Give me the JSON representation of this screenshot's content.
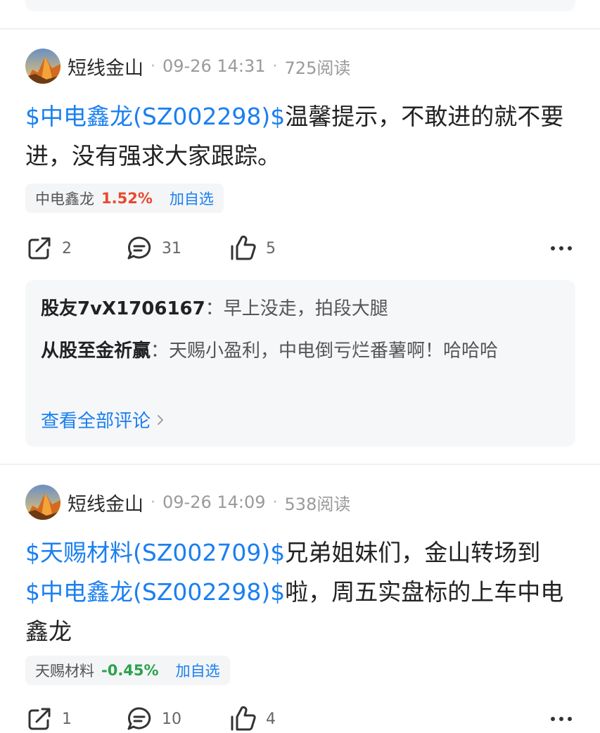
{
  "posts": [
    {
      "author": "短线金山",
      "dot": "·",
      "time": "09-26 14:31",
      "reads": "725阅读",
      "content_parts": [
        {
          "text": "$中电鑫龙(SZ002298)$",
          "link": true
        },
        {
          "text": "温馨提示，不敢进的就不要进，没有强求大家跟踪。",
          "link": false
        }
      ],
      "stock_chip": {
        "name": "中电鑫龙",
        "change": "1.52%",
        "direction": "up",
        "add_label": "加自选"
      },
      "actions": {
        "share": "2",
        "comment": "31",
        "like": "5"
      },
      "comments": [
        {
          "user": "股友7vX1706167",
          "sep": "：",
          "text": "早上没走，拍段大腿"
        },
        {
          "user": "从股至金祈赢",
          "sep": "：",
          "text": "天赐小盈利，中电倒亏烂番薯啊！哈哈哈"
        }
      ],
      "view_all_label": "查看全部评论"
    },
    {
      "author": "短线金山",
      "dot": "·",
      "time": "09-26 14:09",
      "reads": "538阅读",
      "content_parts": [
        {
          "text": "$天赐材料(SZ002709)$",
          "link": true
        },
        {
          "text": "兄弟姐妹们，金山转场到",
          "link": false
        },
        {
          "text": "$中电鑫龙(SZ002298)$",
          "link": true
        },
        {
          "text": "啦，周五实盘标的上车中电鑫龙",
          "link": false
        }
      ],
      "stock_chip": {
        "name": "天赐材料",
        "change": "-0.45%",
        "direction": "down",
        "add_label": "加自选"
      },
      "actions": {
        "share": "1",
        "comment": "10",
        "like": "4"
      }
    }
  ],
  "colors": {
    "link": "#1a7ff0",
    "up": "#e8492d",
    "down": "#2ba24c"
  },
  "icons": [
    "share-icon",
    "comment-icon",
    "like-icon",
    "more-icon",
    "chevron-right-icon",
    "mountain-avatar"
  ]
}
